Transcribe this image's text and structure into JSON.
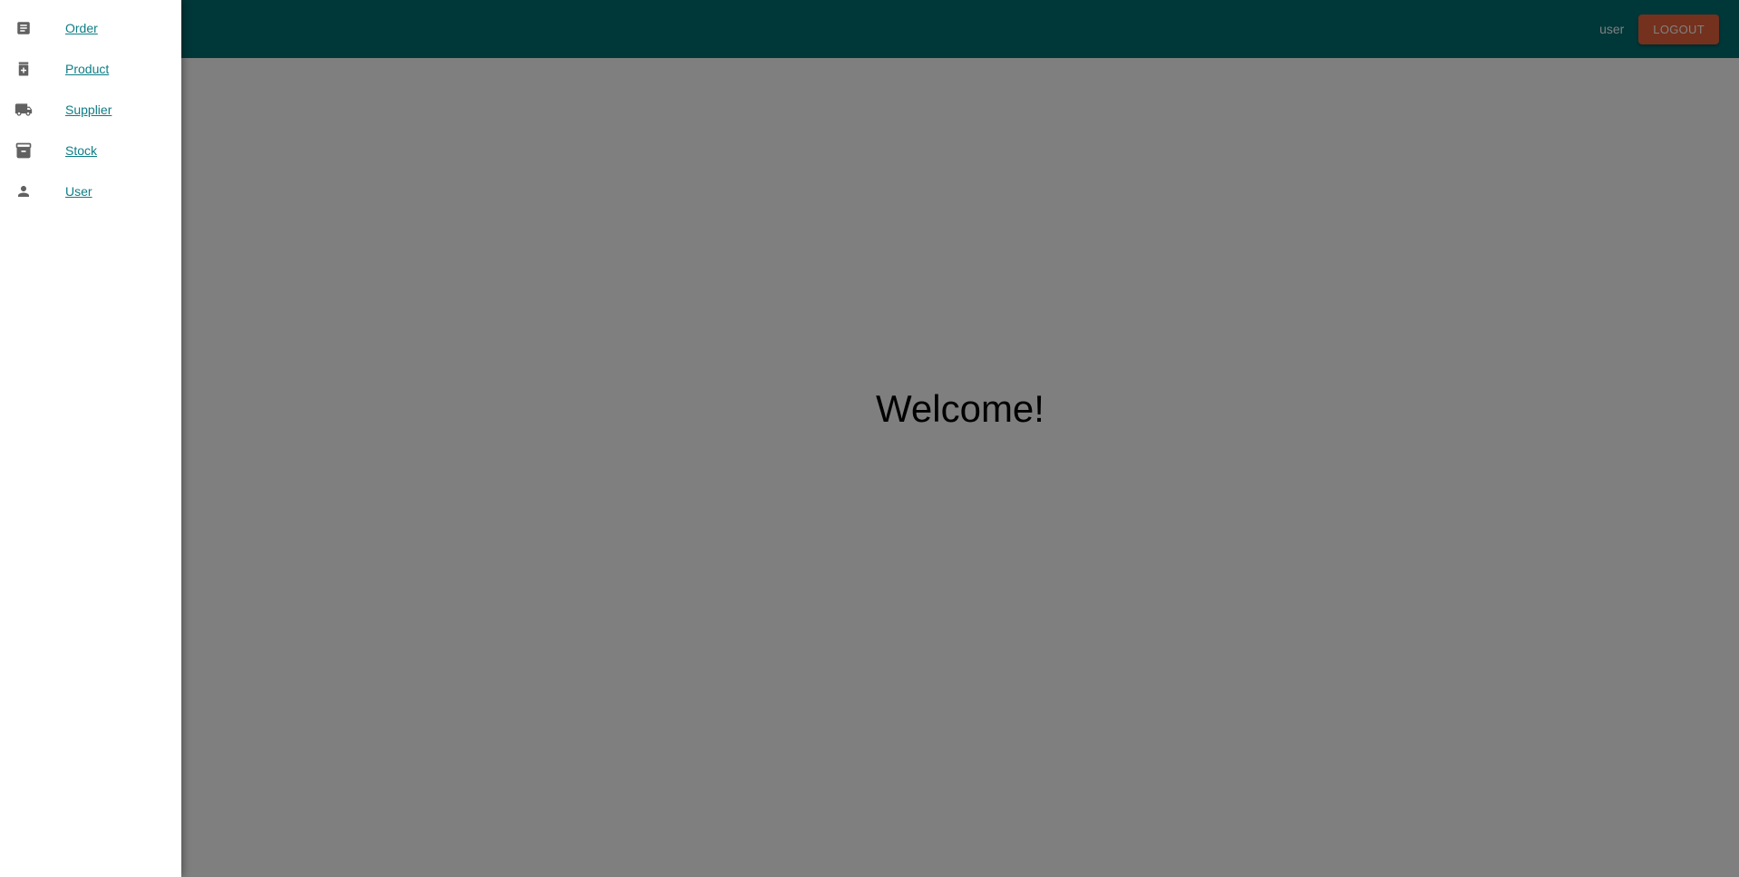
{
  "header": {
    "username": "user",
    "logout_label": "LOGOUT"
  },
  "main": {
    "welcome_text": "Welcome!"
  },
  "sidebar": {
    "items": [
      {
        "label": "Order",
        "icon": "order-icon"
      },
      {
        "label": "Product",
        "icon": "product-icon"
      },
      {
        "label": "Supplier",
        "icon": "truck-icon"
      },
      {
        "label": "Stock",
        "icon": "archive-icon"
      },
      {
        "label": "User",
        "icon": "person-icon"
      }
    ]
  },
  "colors": {
    "appbar": "#006f73",
    "accent_button": "#e8633a",
    "link": "#0d7d86"
  }
}
